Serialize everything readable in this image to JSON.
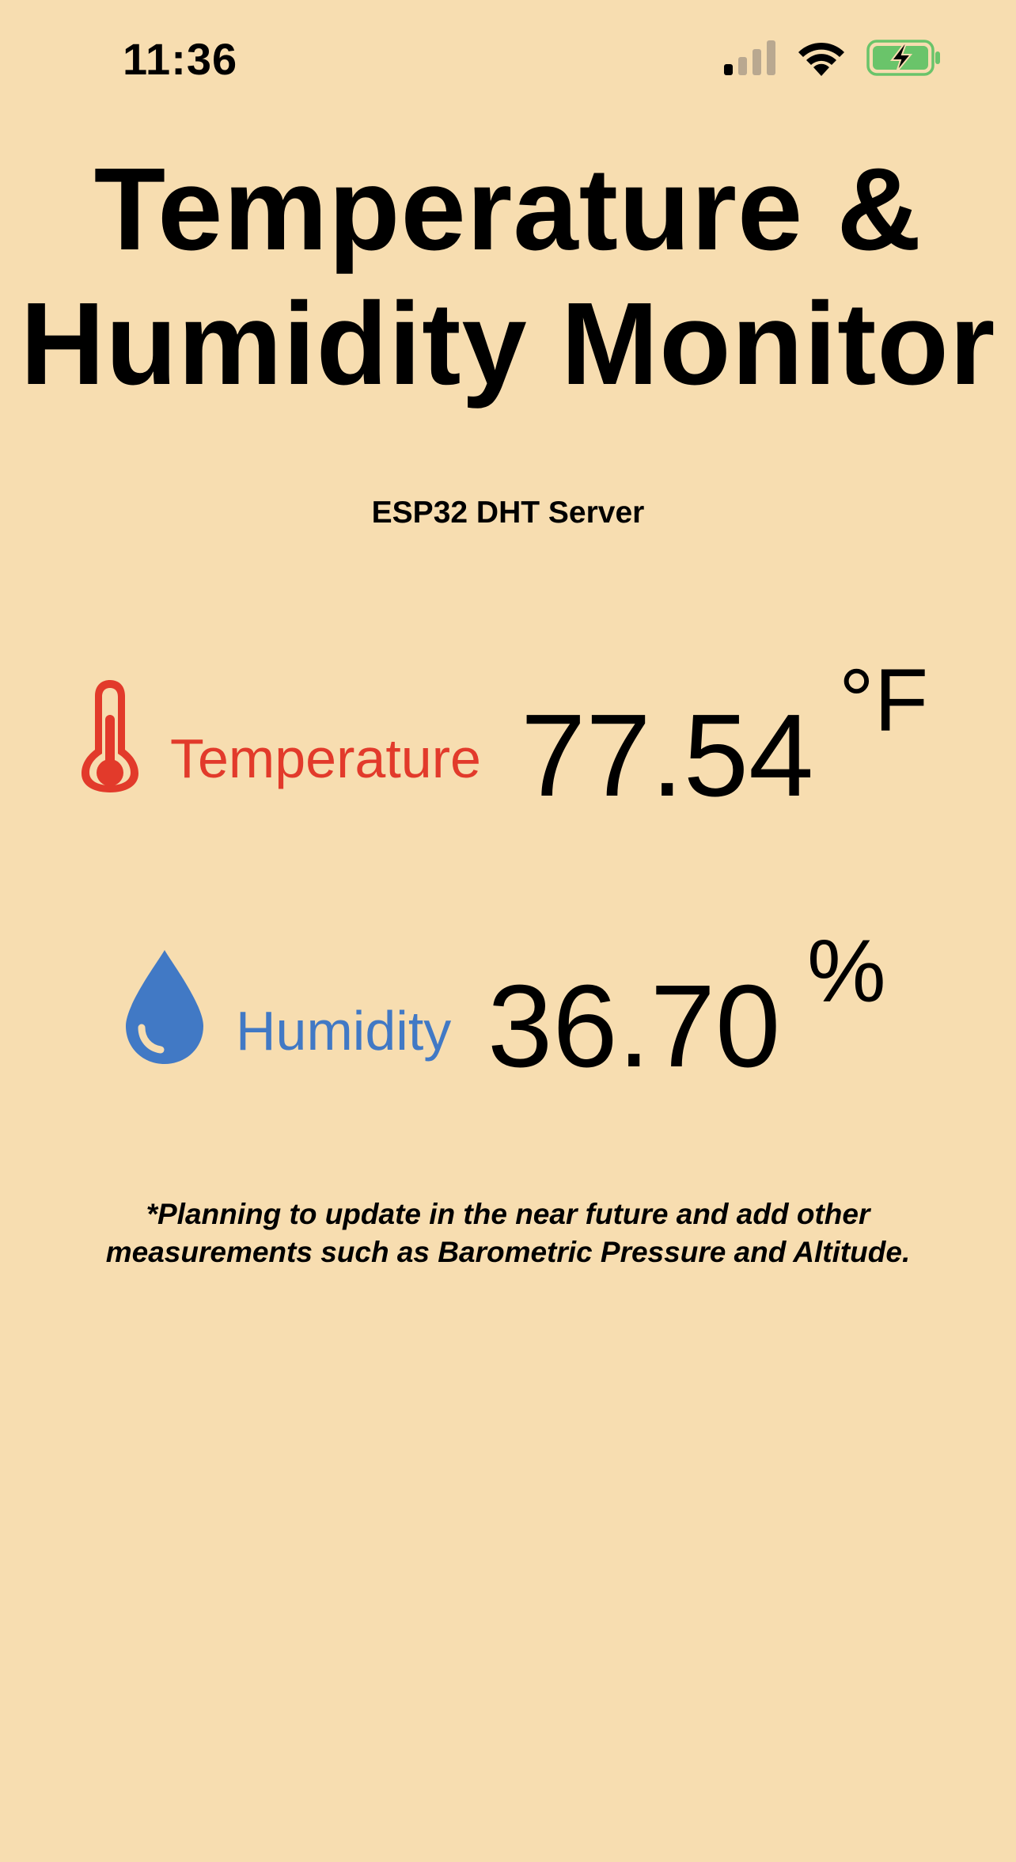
{
  "status_bar": {
    "time": "11:36",
    "icons": [
      "cellular-signal-icon",
      "wifi-icon",
      "battery-charging-icon"
    ],
    "battery_color": "#6ac46a"
  },
  "header": {
    "title_line1": "Temperature &",
    "title_line2": "Humidity Monitor",
    "subtitle": "ESP32 DHT Server"
  },
  "readings": {
    "temperature": {
      "icon": "thermometer-icon",
      "label": "Temperature",
      "value": "77.54",
      "unit": "°F",
      "color": "#e23a2b"
    },
    "humidity": {
      "icon": "water-drop-icon",
      "label": "Humidity",
      "value": "36.70",
      "unit": "%",
      "color": "#4179c5"
    }
  },
  "footnote": {
    "line1": "*Planning to update in the near future and add other",
    "line2": "measurements such as Barometric Pressure and Altitude."
  },
  "colors": {
    "background": "#f7ddb0",
    "text": "#000000"
  }
}
